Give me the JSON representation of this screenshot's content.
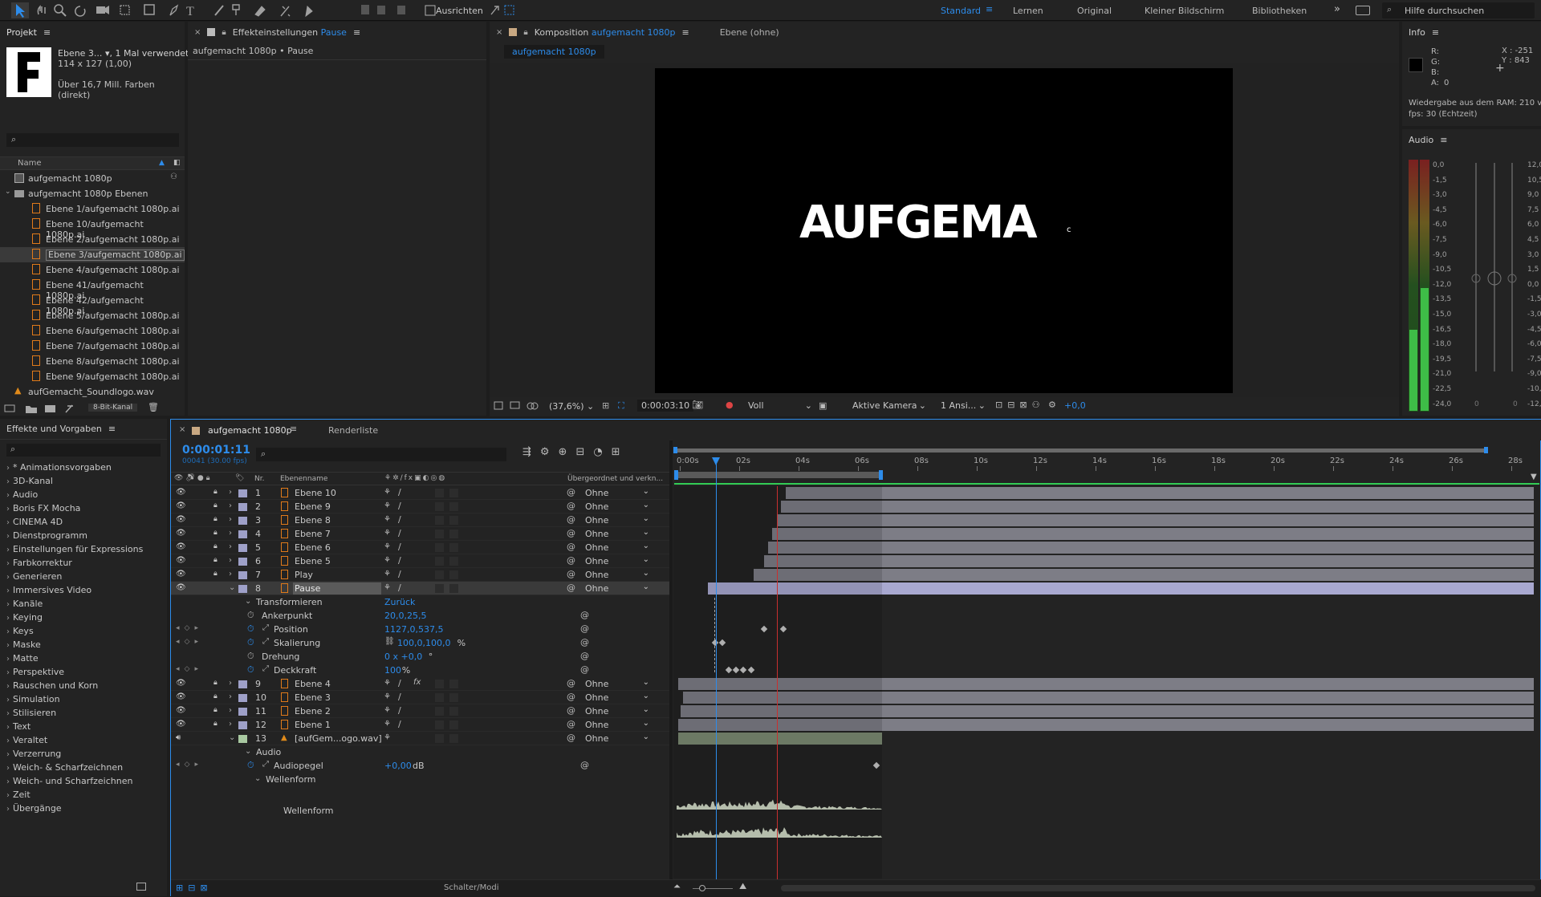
{
  "toolbar": {
    "align_label": "Ausrichten",
    "workspaces": [
      "Standard",
      "Lernen",
      "Original",
      "Kleiner Bildschirm",
      "Bibliotheken"
    ],
    "search_placeholder": "Hilfe durchsuchen"
  },
  "project": {
    "title": "Projekt",
    "item_name": "Ebene 3...",
    "usage": ", 1 Mal verwendet",
    "dims": "114 x 127 (1,00)",
    "colors": "Über 16,7 Mill. Farben (direkt)",
    "col_name": "Name",
    "footer_bits": "8-Bit-Kanal",
    "items": [
      {
        "label": "aufgemacht 1080p",
        "type": "comp",
        "indent": 0
      },
      {
        "label": "aufgemacht 1080p Ebenen",
        "type": "folder",
        "indent": 0
      },
      {
        "label": "Ebene 1/aufgemacht 1080p.ai",
        "type": "ai",
        "indent": 1
      },
      {
        "label": "Ebene 10/aufgemacht 1080p.ai",
        "type": "ai",
        "indent": 1
      },
      {
        "label": "Ebene 2/aufgemacht 1080p.ai",
        "type": "ai",
        "indent": 1
      },
      {
        "label": "Ebene 3/aufgemacht 1080p.ai",
        "type": "ai",
        "indent": 1,
        "selected": true
      },
      {
        "label": "Ebene 4/aufgemacht 1080p.ai",
        "type": "ai",
        "indent": 1
      },
      {
        "label": "Ebene 41/aufgemacht 1080p.ai",
        "type": "ai",
        "indent": 1
      },
      {
        "label": "Ebene 42/aufgemacht 1080p.ai",
        "type": "ai",
        "indent": 1
      },
      {
        "label": "Ebene 5/aufgemacht 1080p.ai",
        "type": "ai",
        "indent": 1
      },
      {
        "label": "Ebene 6/aufgemacht 1080p.ai",
        "type": "ai",
        "indent": 1
      },
      {
        "label": "Ebene 7/aufgemacht 1080p.ai",
        "type": "ai",
        "indent": 1
      },
      {
        "label": "Ebene 8/aufgemacht 1080p.ai",
        "type": "ai",
        "indent": 1
      },
      {
        "label": "Ebene 9/aufgemacht 1080p.ai",
        "type": "ai",
        "indent": 1
      },
      {
        "label": "aufGemacht_Soundlogo.wav",
        "type": "audio",
        "indent": 0
      }
    ]
  },
  "effect_controls": {
    "title": "Effekteinstellungen",
    "layer": "Pause",
    "breadcrumb": "aufgemacht 1080p • Pause"
  },
  "composition": {
    "title": "Komposition",
    "comp": "aufgemacht 1080p",
    "layer_tab": "Ebene (ohne)",
    "subtab": "aufgemacht 1080p",
    "logo_text": "AUFGEMA",
    "logo_small": "c",
    "footer": {
      "zoom": "(37,6%)",
      "time": "0:00:03:10",
      "quality": "Voll",
      "camera": "Aktive Kamera",
      "views": "1 Ansi...",
      "exposure": "+0,0"
    }
  },
  "info": {
    "title": "Info",
    "r": "R:",
    "g": "G:",
    "b": "B:",
    "a": "A:",
    "a_val": "0",
    "x": "X : -251",
    "y": "Y : 843",
    "ram": "Wiedergabe aus dem RAM: 210 v",
    "fps": "fps: 30 (Echtzeit)"
  },
  "audio": {
    "title": "Audio",
    "left_scale": [
      "0,0",
      "-1,5",
      "-3,0",
      "-4,5",
      "-6,0",
      "-7,5",
      "-9,0",
      "-10,5",
      "-12,0",
      "-13,5",
      "-15,0",
      "-16,5",
      "-18,0",
      "-19,5",
      "-21,0",
      "-22,5",
      "-24,0"
    ],
    "right_scale": [
      "12,0",
      "10,5",
      "9,0",
      "7,5",
      "6,0",
      "4,5",
      "3,0",
      "1,5",
      "0,0",
      "-1,5",
      "-3,0",
      "-4,5",
      "-6,0",
      "-7,5",
      "-9,0",
      "-10,5",
      "-12,"
    ],
    "fader_left": "0",
    "fader_right": "0"
  },
  "effects": {
    "title": "Effekte und Vorgaben",
    "items": [
      "* Animationsvorgaben",
      "3D-Kanal",
      "Audio",
      "Boris FX Mocha",
      "CINEMA 4D",
      "Dienstprogramm",
      "Einstellungen für Expressions",
      "Farbkorrektur",
      "Generieren",
      "Immersives Video",
      "Kanäle",
      "Keying",
      "Keys",
      "Maske",
      "Matte",
      "Perspektive",
      "Rauschen und Korn",
      "Simulation",
      "Stilisieren",
      "Text",
      "Veraltet",
      "Verzerrung",
      "Weich- & Scharfzeichnen",
      "Weich- und Scharfzeichnen",
      "Zeit",
      "Übergänge"
    ]
  },
  "timeline": {
    "tab": "aufgemacht 1080p",
    "render_tab": "Renderliste",
    "timecode": "0:00:01:11",
    "frames": "00041 (30.00 fps)",
    "col_nr": "Nr.",
    "col_name": "Ebenenname",
    "col_parent": "Übergeordnet und verkn...",
    "ruler": [
      "0:00s",
      "02s",
      "04s",
      "06s",
      "08s",
      "10s",
      "12s",
      "14s",
      "16s",
      "18s",
      "20s",
      "22s",
      "24s",
      "26s",
      "28s"
    ],
    "layers_top": [
      {
        "nr": "1",
        "name": "Ebene 10",
        "parent": "Ohne",
        "bar_start": 0.126
      },
      {
        "nr": "2",
        "name": "Ebene 9",
        "parent": "Ohne",
        "bar_start": 0.12
      },
      {
        "nr": "3",
        "name": "Ebene 8",
        "parent": "Ohne",
        "bar_start": 0.115
      },
      {
        "nr": "4",
        "name": "Ebene 7",
        "parent": "Ohne",
        "bar_start": 0.11
      },
      {
        "nr": "5",
        "name": "Ebene 6",
        "parent": "Ohne",
        "bar_start": 0.105
      },
      {
        "nr": "6",
        "name": "Ebene 5",
        "parent": "Ohne",
        "bar_start": 0.1
      },
      {
        "nr": "7",
        "name": "Play",
        "parent": "Ohne",
        "bar_start": 0.088
      }
    ],
    "layer_selected": {
      "nr": "8",
      "name": "Pause",
      "parent": "Ohne",
      "bar_start": 0.035
    },
    "transform": {
      "label": "Transformieren",
      "reset": "Zurück",
      "props": [
        {
          "name": "Ankerpunkt",
          "value": "20,0,25,5",
          "unit": ""
        },
        {
          "name": "Position",
          "value": "1127,0,537,5",
          "unit": ""
        },
        {
          "name": "Skalierung",
          "value": "100,0,100,0",
          "unit": "%"
        },
        {
          "name": "Drehung",
          "value": "0 x +0,0",
          "unit": "°"
        },
        {
          "name": "Deckkraft",
          "value": "100",
          "unit": "%"
        }
      ]
    },
    "layers_bottom": [
      {
        "nr": "9",
        "name": "Ebene 4",
        "parent": "Ohne",
        "bar_start": 0.0
      },
      {
        "nr": "10",
        "name": "Ebene 3",
        "parent": "Ohne",
        "bar_start": 0.006
      },
      {
        "nr": "11",
        "name": "Ebene 2",
        "parent": "Ohne",
        "bar_start": 0.003
      },
      {
        "nr": "12",
        "name": "Ebene 1",
        "parent": "Ohne",
        "bar_start": 0.0
      }
    ],
    "audio_layer": {
      "nr": "13",
      "name": "[aufGem...ogo.wav]",
      "parent": "Ohne",
      "group": "Audio",
      "prop": "Audiopegel",
      "value": "+0,00",
      "unit": "dB",
      "waveform_group": "Wellenform",
      "waveform_label": "Wellenform"
    },
    "footer": "Schalter/Modi"
  }
}
